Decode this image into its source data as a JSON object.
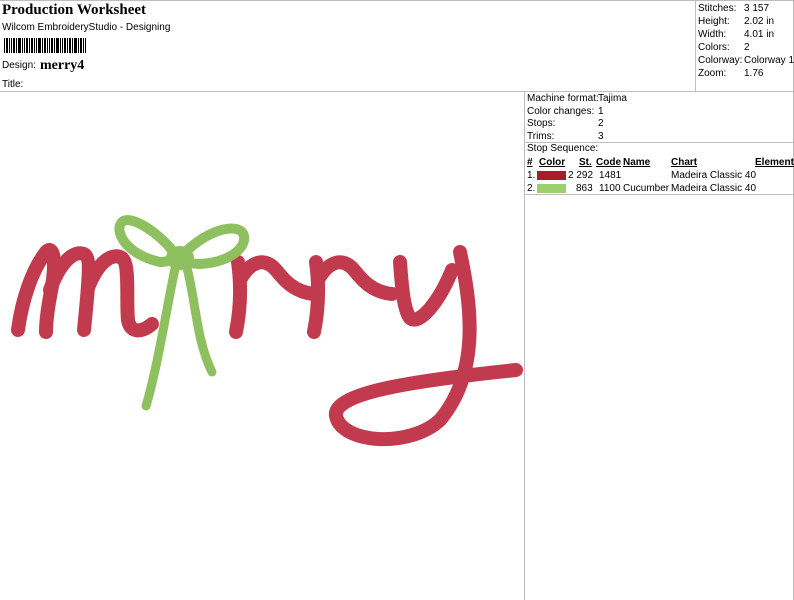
{
  "header": {
    "title": "Production Worksheet",
    "software": "Wilcom EmbroideryStudio - Designing",
    "design_label": "Design:",
    "design_value": "merry4",
    "title_label": "Title:"
  },
  "stats": [
    {
      "label": "Stitches:",
      "value": "3 157"
    },
    {
      "label": "Height:",
      "value": "2.02 in"
    },
    {
      "label": "Width:",
      "value": "4.01 in"
    },
    {
      "label": "Colors:",
      "value": "2"
    },
    {
      "label": "Colorway:",
      "value": "Colorway 1"
    },
    {
      "label": "Zoom:",
      "value": "1.76"
    }
  ],
  "machine": [
    {
      "label": "Machine format:",
      "value": "Tajima"
    },
    {
      "label": "Color changes:",
      "value": "1"
    },
    {
      "label": "Stops:",
      "value": "2"
    },
    {
      "label": "Trims:",
      "value": "3"
    }
  ],
  "stop_sequence": {
    "label": "Stop Sequence:",
    "headers": {
      "num": "#",
      "color": "Color",
      "st": "St.",
      "code": "Code",
      "name": "Name",
      "chart": "Chart",
      "element": "Element"
    },
    "rows": [
      {
        "num": "1.",
        "color": "#a51c2c",
        "st": "2 292",
        "code": "1481",
        "name": "",
        "chart": "Madeira Classic 40"
      },
      {
        "num": "2.",
        "color": "#9ccf6d",
        "st": "863",
        "code": "1100",
        "name": "Cucumber",
        "chart": "Madeira Classic 40"
      }
    ]
  },
  "artwork": {
    "text": "merry",
    "thread_red": "#c23a4e",
    "thread_green": "#8fc060"
  }
}
